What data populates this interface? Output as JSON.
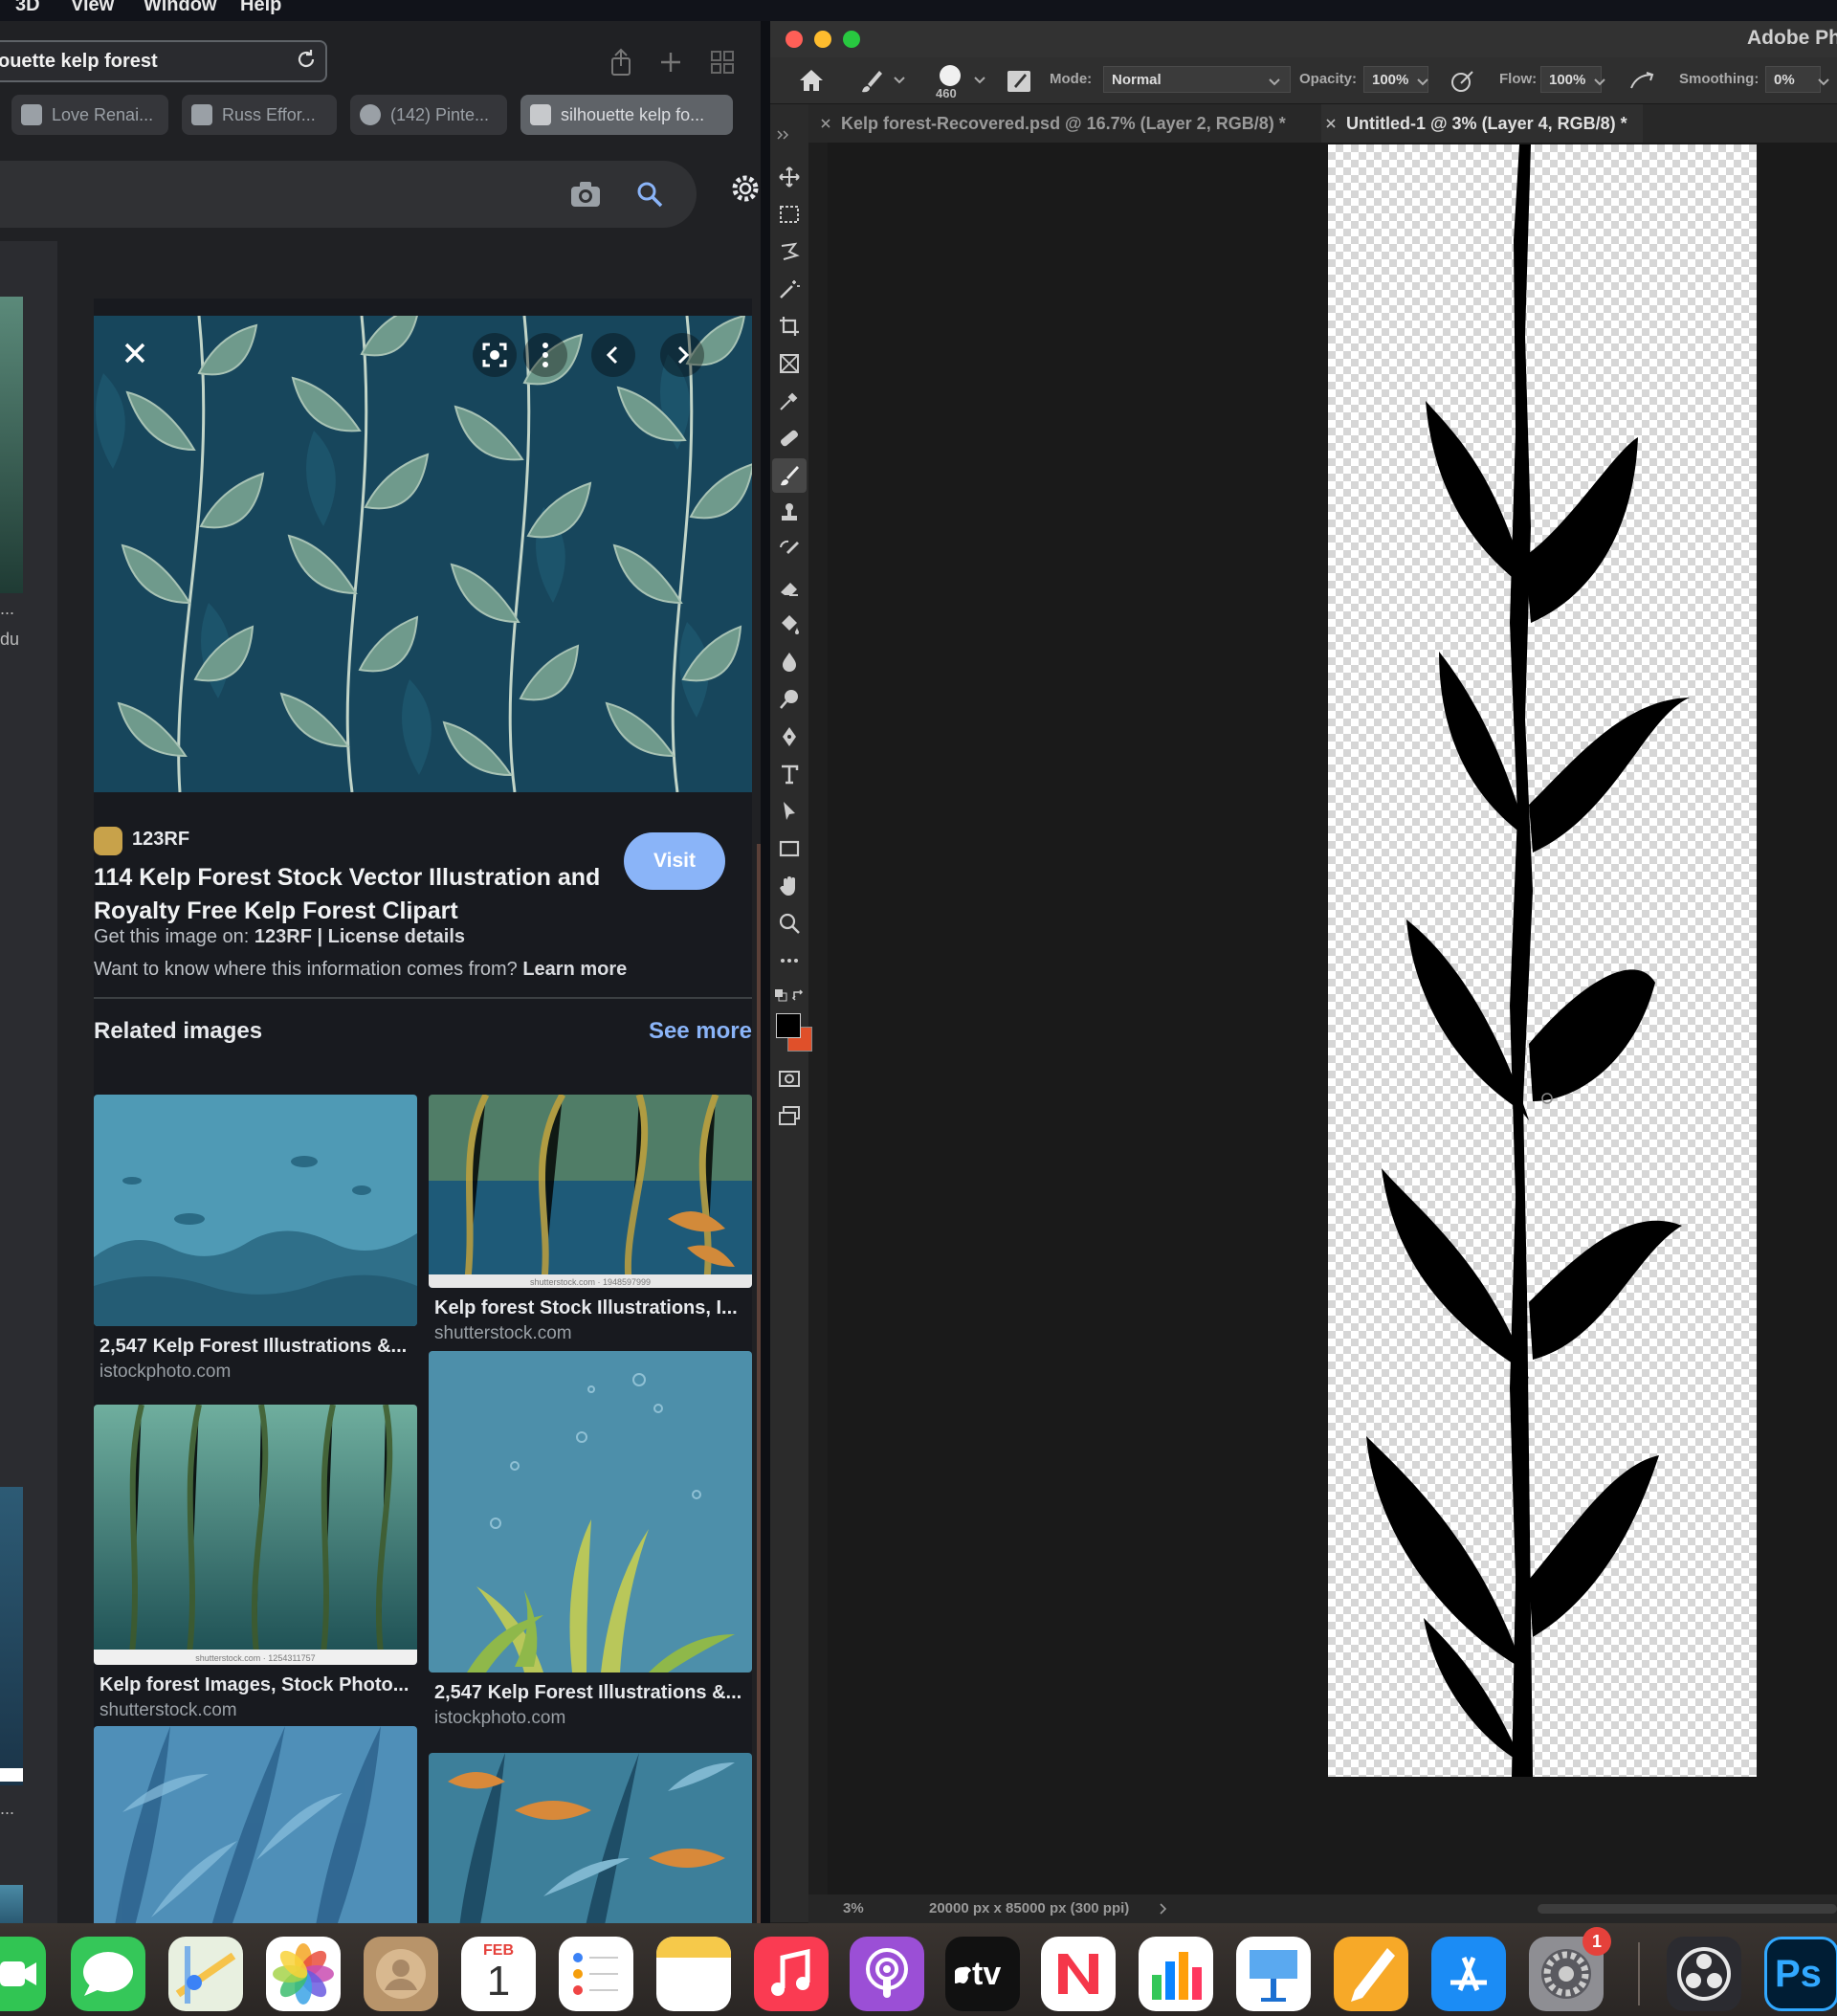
{
  "menubar": {
    "items": [
      "3D",
      "View",
      "Window",
      "Help"
    ]
  },
  "browser": {
    "address": "ouette kelp forest",
    "tabs": [
      {
        "label": "Love Renai..."
      },
      {
        "label": "Russ Effor..."
      },
      {
        "label": "(142) Pinte..."
      },
      {
        "label": "silhouette kelp fo..."
      }
    ],
    "strip_text": [
      "...",
      "du",
      "...",
      "..."
    ],
    "result": {
      "source": "123RF",
      "title": "114 Kelp Forest Stock Vector Illustration and Royalty Free Kelp Forest Clipart",
      "visit": "Visit",
      "get_image_prefix": "Get this image on: ",
      "get_image_source": "123RF | License details",
      "info_prefix": "Want to know where this information comes from? ",
      "info_link": "Learn more"
    },
    "related": {
      "title": "Related images",
      "see_more": "See more",
      "items": [
        {
          "title": "2,547 Kelp Forest Illustrations &...",
          "source": "istockphoto.com"
        },
        {
          "title": "Kelp forest Stock Illustrations, I...",
          "source": "shutterstock.com"
        },
        {
          "title": "Kelp forest Images, Stock Photo...",
          "source": "shutterstock.com"
        },
        {
          "title": "2,547 Kelp Forest Illustrations &...",
          "source": "istockphoto.com"
        }
      ],
      "watermarks": [
        "shutterstock.com · 1948597999",
        "shutterstock.com · 1254311757"
      ]
    }
  },
  "photoshop": {
    "app_title": "Adobe Ph",
    "brush_size": "460",
    "options": {
      "mode_label": "Mode:",
      "mode_value": "Normal",
      "opacity_label": "Opacity:",
      "opacity_value": "100%",
      "flow_label": "Flow:",
      "flow_value": "100%",
      "smoothing_label": "Smoothing:",
      "smoothing_value": "0%"
    },
    "doc_tabs": [
      {
        "label": "Kelp forest-Recovered.psd @ 16.7% (Layer 2, RGB/8) *"
      },
      {
        "label": "Untitled-1 @ 3% (Layer 4, RGB/8) *"
      }
    ],
    "status": {
      "zoom": "3%",
      "doc_info": "20000 px x 85000 px (300 ppi)"
    },
    "colors": {
      "foreground": "#000000",
      "background": "#e0502a"
    }
  },
  "dock": {
    "calendar_month": "FEB",
    "calendar_day": "1",
    "tv_label": "tv",
    "ps_label": "Ps",
    "settings_badge": "1",
    "icons": [
      "facetime-icon",
      "messages-icon",
      "maps-icon",
      "photos-icon",
      "contacts-icon",
      "calendar-icon",
      "reminders-icon",
      "notes-icon",
      "music-icon",
      "podcasts-icon",
      "apple-tv-icon",
      "news-icon",
      "numbers-icon",
      "keynote-icon",
      "pages-icon",
      "app-store-icon",
      "system-settings-icon",
      "obs-icon",
      "photoshop-icon"
    ]
  }
}
